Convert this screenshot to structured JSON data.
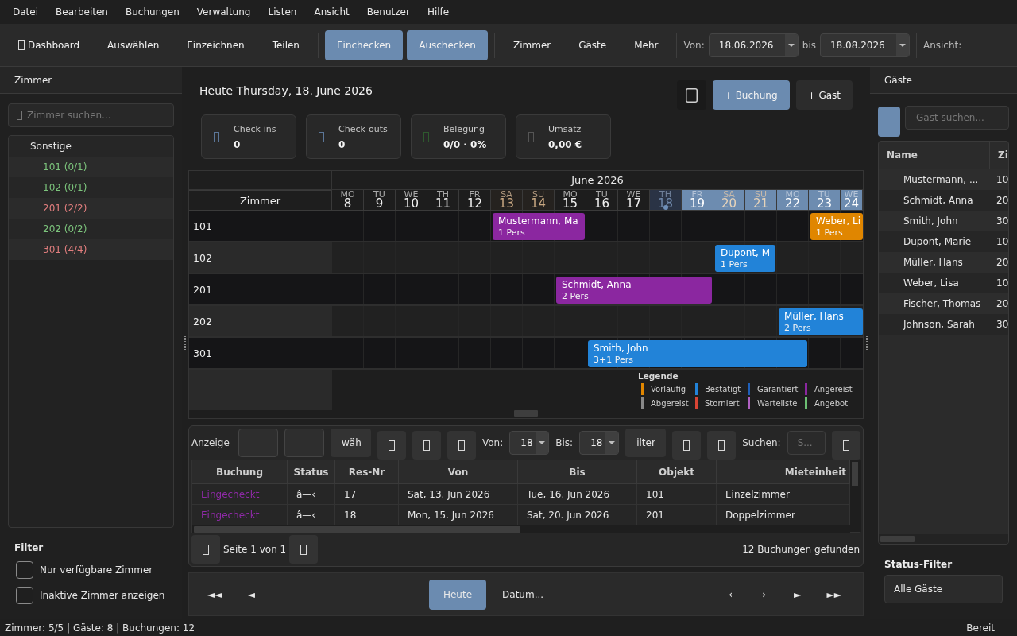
{
  "menu": [
    "Datei",
    "Bearbeiten",
    "Buchungen",
    "Verwaltung",
    "Listen",
    "Ansicht",
    "Benutzer",
    "Hilfe"
  ],
  "toolbar": [
    {
      "kind": "button",
      "label": "Dashboard",
      "icon": true,
      "primary": false
    },
    {
      "kind": "button",
      "label": "Auswählen",
      "primary": false
    },
    {
      "kind": "button",
      "label": "Einzeichnen",
      "primary": false
    },
    {
      "kind": "button",
      "label": "Teilen",
      "primary": false
    },
    {
      "kind": "separator"
    },
    {
      "kind": "button",
      "label": "Einchecken",
      "primary": true
    },
    {
      "kind": "button",
      "label": "Auschecken",
      "primary": true
    },
    {
      "kind": "separator"
    },
    {
      "kind": "button",
      "label": "Zimmer",
      "primary": false
    },
    {
      "kind": "button",
      "label": "Gäste",
      "primary": false
    },
    {
      "kind": "button",
      "label": "Mehr",
      "primary": false
    },
    {
      "kind": "separator"
    },
    {
      "kind": "label",
      "text": "Von:"
    },
    {
      "kind": "date",
      "value": "18.06.2026"
    },
    {
      "kind": "label",
      "text": "bis"
    },
    {
      "kind": "date",
      "value": "18.08.2026"
    },
    {
      "kind": "separator"
    },
    {
      "kind": "label",
      "text": "Ansicht:"
    }
  ],
  "rooms_panel": {
    "title": "Zimmer",
    "search_placeholder": "Zimmer suchen...",
    "tree": [
      {
        "label": "Sonstige",
        "children": [
          {
            "label": "101 (0/1)",
            "color": "#7cc47c"
          },
          {
            "label": "102 (0/1)",
            "color": "#7cc47c"
          },
          {
            "label": "201 (2/2)",
            "color": "#e27e7e"
          },
          {
            "label": "202 (0/2)",
            "color": "#7cc47c"
          },
          {
            "label": "301 (4/4)",
            "color": "#e27e7e"
          }
        ]
      }
    ],
    "filter": {
      "title": "Filter",
      "options": [
        {
          "label": "Nur verfügbare Zimmer",
          "checked": false
        },
        {
          "label": "Inaktive Zimmer anzeigen",
          "checked": false
        }
      ]
    }
  },
  "dashboard": {
    "today": "Heute Thursday, 18. June 2026",
    "actions": [
      {
        "kind": "icon",
        "primary": false
      },
      {
        "kind": "text",
        "label": "+ Buchung",
        "primary": true
      },
      {
        "kind": "text",
        "label": "+ Gast",
        "primary": false
      }
    ],
    "stats": [
      {
        "label": "Check-ins",
        "value": "0",
        "color": "#5b7698"
      },
      {
        "label": "Check-outs",
        "value": "0",
        "color": "#5b7698"
      },
      {
        "label": "Belegung",
        "value": "0/0 · 0%",
        "color": "#2e5a2e"
      },
      {
        "label": "Umsatz",
        "value": "0,00 €",
        "color": "#555555"
      }
    ]
  },
  "timeline": {
    "month": "June 2026",
    "room_header": "Zimmer",
    "days": [
      {
        "dow": "MO",
        "day": "8",
        "weekend": false,
        "in_range": false,
        "today": false
      },
      {
        "dow": "TU",
        "day": "9",
        "weekend": false,
        "in_range": false,
        "today": false
      },
      {
        "dow": "WE",
        "day": "10",
        "weekend": false,
        "in_range": false,
        "today": false
      },
      {
        "dow": "TH",
        "day": "11",
        "weekend": false,
        "in_range": false,
        "today": false
      },
      {
        "dow": "FR",
        "day": "12",
        "weekend": false,
        "in_range": false,
        "today": false
      },
      {
        "dow": "SA",
        "day": "13",
        "weekend": true,
        "in_range": false,
        "today": false
      },
      {
        "dow": "SU",
        "day": "14",
        "weekend": true,
        "in_range": false,
        "today": false
      },
      {
        "dow": "MO",
        "day": "15",
        "weekend": false,
        "in_range": false,
        "today": false
      },
      {
        "dow": "TU",
        "day": "16",
        "weekend": false,
        "in_range": false,
        "today": false
      },
      {
        "dow": "WE",
        "day": "17",
        "weekend": false,
        "in_range": false,
        "today": false
      },
      {
        "dow": "TH",
        "day": "18",
        "weekend": false,
        "in_range": false,
        "today": true
      },
      {
        "dow": "FR",
        "day": "19",
        "weekend": false,
        "in_range": true,
        "today": false
      },
      {
        "dow": "SA",
        "day": "20",
        "weekend": true,
        "in_range": true,
        "today": false
      },
      {
        "dow": "SU",
        "day": "21",
        "weekend": true,
        "in_range": true,
        "today": false
      },
      {
        "dow": "MO",
        "day": "22",
        "weekend": false,
        "in_range": true,
        "today": false
      },
      {
        "dow": "TU",
        "day": "23",
        "weekend": false,
        "in_range": true,
        "today": false
      },
      {
        "dow": "WE",
        "day": "24",
        "weekend": false,
        "in_range": true,
        "today": false
      }
    ],
    "rooms": [
      {
        "name": "101",
        "slots": [
          {
            "kind": "free"
          },
          {
            "kind": "free"
          },
          {
            "kind": "free"
          },
          {
            "kind": "free"
          },
          {
            "kind": "free"
          },
          {
            "kind": "arrival",
            "guest": "Mustermann, Ma",
            "persons": "1 Pers",
            "color": "#8b27a0"
          },
          {
            "kind": "stay"
          },
          {
            "kind": "stay"
          },
          {
            "kind": "free"
          },
          {
            "kind": "free"
          },
          {
            "kind": "free"
          },
          {
            "kind": "free"
          },
          {
            "kind": "free"
          },
          {
            "kind": "free"
          },
          {
            "kind": "free"
          },
          {
            "kind": "arrival",
            "guest": "Weber, Li",
            "persons": "1 Pers",
            "color": "#e08600"
          },
          {
            "kind": "stay"
          }
        ]
      },
      {
        "name": "102",
        "slots": [
          {
            "kind": "free"
          },
          {
            "kind": "free"
          },
          {
            "kind": "free"
          },
          {
            "kind": "free"
          },
          {
            "kind": "free"
          },
          {
            "kind": "free"
          },
          {
            "kind": "free"
          },
          {
            "kind": "free"
          },
          {
            "kind": "free"
          },
          {
            "kind": "free"
          },
          {
            "kind": "free"
          },
          {
            "kind": "free"
          },
          {
            "kind": "arrival",
            "guest": "Dupont, M",
            "persons": "1 Pers",
            "color": "#2283d8"
          },
          {
            "kind": "stay"
          },
          {
            "kind": "free"
          },
          {
            "kind": "free"
          },
          {
            "kind": "free"
          }
        ]
      },
      {
        "name": "201",
        "slots": [
          {
            "kind": "free"
          },
          {
            "kind": "free"
          },
          {
            "kind": "free"
          },
          {
            "kind": "free"
          },
          {
            "kind": "free"
          },
          {
            "kind": "free"
          },
          {
            "kind": "free"
          },
          {
            "kind": "arrival",
            "guest": "Schmidt, Anna",
            "persons": "2 Pers",
            "color": "#8b27a0"
          },
          {
            "kind": "stay"
          },
          {
            "kind": "stay"
          },
          {
            "kind": "stay"
          },
          {
            "kind": "stay"
          },
          {
            "kind": "free"
          },
          {
            "kind": "free"
          },
          {
            "kind": "free"
          },
          {
            "kind": "free"
          },
          {
            "kind": "free"
          }
        ]
      },
      {
        "name": "202",
        "slots": [
          {
            "kind": "free"
          },
          {
            "kind": "free"
          },
          {
            "kind": "free"
          },
          {
            "kind": "free"
          },
          {
            "kind": "free"
          },
          {
            "kind": "free"
          },
          {
            "kind": "free"
          },
          {
            "kind": "free"
          },
          {
            "kind": "free"
          },
          {
            "kind": "free"
          },
          {
            "kind": "free"
          },
          {
            "kind": "free"
          },
          {
            "kind": "free"
          },
          {
            "kind": "free"
          },
          {
            "kind": "arrival",
            "guest": "Müller, Hans",
            "persons": "2 Pers",
            "color": "#2283d8"
          },
          {
            "kind": "stay"
          },
          {
            "kind": "stay"
          }
        ]
      },
      {
        "name": "301",
        "slots": [
          {
            "kind": "free"
          },
          {
            "kind": "free"
          },
          {
            "kind": "free"
          },
          {
            "kind": "free"
          },
          {
            "kind": "free"
          },
          {
            "kind": "free"
          },
          {
            "kind": "free"
          },
          {
            "kind": "free"
          },
          {
            "kind": "arrival",
            "guest": "Smith, John",
            "persons": "3+1 Pers",
            "color": "#2283d8"
          },
          {
            "kind": "stay"
          },
          {
            "kind": "stay"
          },
          {
            "kind": "stay"
          },
          {
            "kind": "stay"
          },
          {
            "kind": "stay"
          },
          {
            "kind": "stay"
          },
          {
            "kind": "free"
          },
          {
            "kind": "free"
          }
        ]
      }
    ],
    "legend": {
      "title": "Legende",
      "items": [
        {
          "label": "Vorläufig",
          "color": "#e08600"
        },
        {
          "label": "Bestätigt",
          "color": "#2283d8"
        },
        {
          "label": "Garantiert",
          "color": "#1f5fb8"
        },
        {
          "label": "Angereist",
          "color": "#8b27a0"
        },
        {
          "label": "Abgereist",
          "color": "#8a8a8a"
        },
        {
          "label": "Storniert",
          "color": "#d84434"
        },
        {
          "label": "Warteliste",
          "color": "#b061c2"
        },
        {
          "label": "Angebot",
          "color": "#6cbf73"
        }
      ]
    }
  },
  "bookings_panel": {
    "toolbar": [
      {
        "kind": "label",
        "text": "Anzeige"
      },
      {
        "kind": "blank"
      },
      {
        "kind": "blank"
      },
      {
        "kind": "button",
        "label": "wäh"
      },
      {
        "kind": "icon"
      },
      {
        "kind": "icon"
      },
      {
        "kind": "icon"
      },
      {
        "kind": "label",
        "text": "Von:"
      },
      {
        "kind": "date",
        "value": "18"
      },
      {
        "kind": "label",
        "text": "Bis:"
      },
      {
        "kind": "date",
        "value": "18"
      },
      {
        "kind": "button",
        "label": "ilter"
      },
      {
        "kind": "icon"
      },
      {
        "kind": "icon"
      },
      {
        "kind": "label",
        "text": "Suchen:"
      },
      {
        "kind": "search",
        "placeholder": "S..."
      },
      {
        "kind": "icon"
      }
    ],
    "columns": [
      "Buchung",
      "Status",
      "Res-Nr",
      "Von",
      "Bis",
      "Objekt",
      "Mieteinheit"
    ],
    "rows": [
      {
        "color": "#8e2aa6",
        "cells": [
          "Eingecheckt",
          "â—‹",
          "17",
          "Sat, 13. Jun 2026",
          "Tue, 16. Jun 2026",
          "101",
          "Einzelzimmer"
        ]
      },
      {
        "color": "#8e2aa6",
        "cells": [
          "Eingecheckt",
          "â—‹",
          "18",
          "Mon, 15. Jun 2026",
          "Sat, 20. Jun 2026",
          "201",
          "Doppelzimmer"
        ]
      }
    ],
    "page": "Seite 1 von 1",
    "count": "12 Buchungen gefunden"
  },
  "navigation": {
    "left": [
      {
        "label": "◄◄",
        "primary": false
      },
      {
        "label": "◄",
        "primary": false
      }
    ],
    "center": [
      {
        "label": "Heute",
        "primary": true
      },
      {
        "label": "Datum...",
        "primary": false
      }
    ],
    "right": [
      {
        "label": "‹",
        "primary": false
      },
      {
        "label": "›",
        "primary": false
      },
      {
        "label": "►",
        "primary": false
      },
      {
        "label": "►►",
        "primary": false
      }
    ]
  },
  "guests_panel": {
    "title": "Gäste",
    "search_placeholder": "Gast suchen...",
    "columns": [
      "Name",
      "Zi"
    ],
    "rows": [
      {
        "name": "Mustermann, ...",
        "room": "10"
      },
      {
        "name": "Schmidt, Anna",
        "room": "20"
      },
      {
        "name": "Smith, John",
        "room": "30"
      },
      {
        "name": "Dupont, Marie",
        "room": "10"
      },
      {
        "name": "Müller, Hans",
        "room": "20"
      },
      {
        "name": "Weber, Lisa",
        "room": "10"
      },
      {
        "name": "Fischer, Thomas",
        "room": "20"
      },
      {
        "name": "Johnson, Sarah",
        "room": "30"
      }
    ],
    "filter_title": "Status-Filter",
    "filter_value": "Alle Gäste"
  },
  "status_bar": {
    "summary": "Zimmer: 5/5 | Gäste: 8 | Buchungen: 12",
    "state": "Bereit"
  }
}
